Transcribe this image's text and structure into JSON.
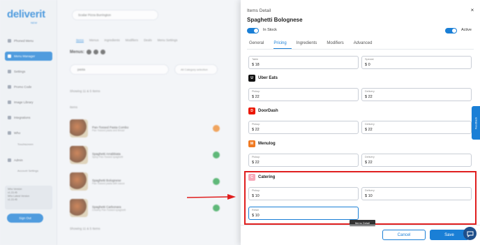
{
  "sidebar": {
    "logo": "deliverit",
    "logo_sub": "NEW",
    "items": [
      {
        "label": "Phoned Menu"
      },
      {
        "label": "Menu Manager"
      },
      {
        "label": "Settings"
      },
      {
        "label": "Promo Code"
      },
      {
        "label": "Image Library"
      },
      {
        "label": "Integrations"
      },
      {
        "label": "Who"
      },
      {
        "label": "Admin"
      }
    ],
    "subitems": [
      "Touchscreen",
      "Account Settings"
    ],
    "info_lines": [
      "Who Version",
      "v1.23.45",
      "Who Latest Version",
      "v1.23.45"
    ],
    "signout_label": "Sign Out"
  },
  "main": {
    "store_select": "Scalar Pizza Burrington",
    "tabs": [
      "Items",
      "Menus",
      "Ingredients",
      "Modifiers",
      "Deals",
      "Menu Settings"
    ],
    "menus_label": "Menus:",
    "search_value": "pasta",
    "category_filter": "All Category selection",
    "showing_top": "Showing 11 & 5 Items",
    "list_header": "Items",
    "rows": [
      {
        "name": "Pan-Tossed Pasta Combo",
        "desc": "Pan-Tossed pasta and Bread",
        "status": "warn"
      },
      {
        "name": "Spaghetti Arrabbiata",
        "desc": "Spicy Pan-Tossed spaghetti",
        "status": "ok"
      },
      {
        "name": "Spaghetti Bolognese",
        "desc": "Pan-Tossed pasta with sauce",
        "status": "ok"
      },
      {
        "name": "Spaghetti Carbonara",
        "desc": "Creamy Pan-Tossed spaghetti",
        "status": "ok"
      }
    ],
    "showing_bottom": "Showing 11 & 5 Items"
  },
  "panel": {
    "subtitle": "Items Detail",
    "title": "Spaghetti Bolognese",
    "close_icon": "×",
    "in_stock_label": "In Stock",
    "active_label": "Active",
    "tabs": [
      "General",
      "Pricing",
      "Ingredients",
      "Modifiers",
      "Advanced"
    ],
    "active_tab": "Pricing",
    "base": {
      "table_label": "Table",
      "table_value": "$ 18",
      "special_label": "Special",
      "special_value": "$ 0"
    },
    "platforms": [
      {
        "name": "Uber Eats",
        "pickup_label": "Pickup",
        "pickup": "$ 22",
        "delivery_label": "Delivery",
        "delivery": "$ 22",
        "color": "#111111"
      },
      {
        "name": "DoorDash",
        "pickup_label": "Pickup",
        "pickup": "$ 22",
        "delivery_label": "Delivery",
        "delivery": "$ 22",
        "color": "#eb1700"
      },
      {
        "name": "Menulog",
        "pickup_label": "Pickup",
        "pickup": "$ 22",
        "delivery_label": "Delivery",
        "delivery": "$ 22",
        "color": "#f07a22"
      },
      {
        "name": "Catering",
        "pickup_label": "Pickup",
        "pickup": "$ 10",
        "delivery_label": "Delivery",
        "delivery": "$ 10",
        "retail_label": "Retail",
        "retail": "$ 10",
        "color": "#f7a8b8"
      }
    ],
    "tooltip": "Items Detail",
    "cancel_label": "Cancel",
    "save_label": "Save"
  },
  "feedback_label": "Feedback",
  "colors": {
    "accent": "#1a7fd6",
    "highlight": "#e01e1e"
  }
}
